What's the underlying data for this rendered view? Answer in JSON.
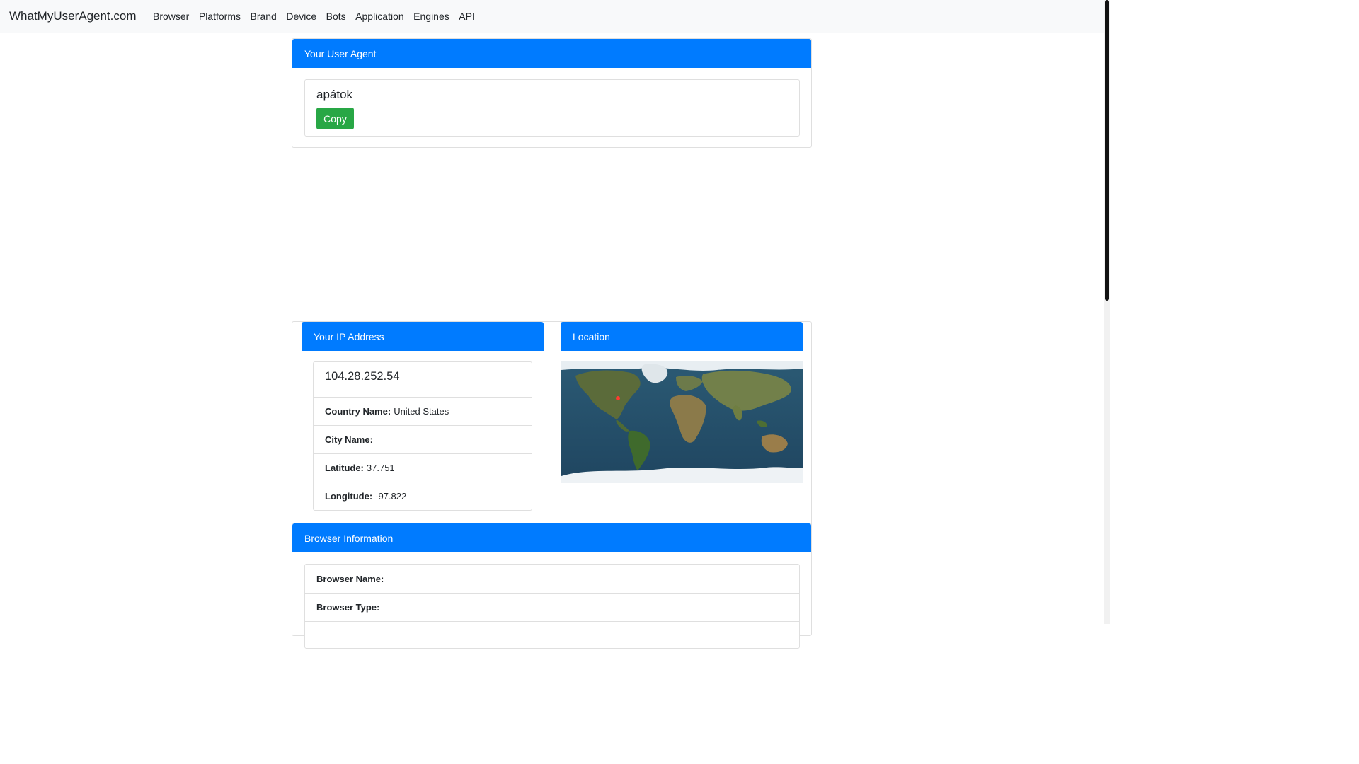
{
  "navbar": {
    "brand": "WhatMyUserAgent.com",
    "links": [
      "Browser",
      "Platforms",
      "Brand",
      "Device",
      "Bots",
      "Application",
      "Engines",
      "API"
    ]
  },
  "user_agent_card": {
    "header": "Your User Agent",
    "value": "apátok",
    "copy_label": "Copy"
  },
  "ip_card": {
    "header": "Your IP Address",
    "ip": "104.28.252.54",
    "rows": [
      {
        "label": "Country Name:",
        "value": "United States"
      },
      {
        "label": "City Name:",
        "value": ""
      },
      {
        "label": "Latitude:",
        "value": "37.751"
      },
      {
        "label": "Longitude:",
        "value": "-97.822"
      }
    ]
  },
  "location_card": {
    "header": "Location"
  },
  "browser_card": {
    "header": "Browser Information",
    "rows": [
      {
        "label": "Browser Name:",
        "value": ""
      },
      {
        "label": "Browser Type:",
        "value": ""
      }
    ]
  },
  "colors": {
    "primary": "#007bff",
    "success": "#28a745",
    "navbar_bg": "#f8f9fa",
    "marker": "#ff3b30"
  }
}
